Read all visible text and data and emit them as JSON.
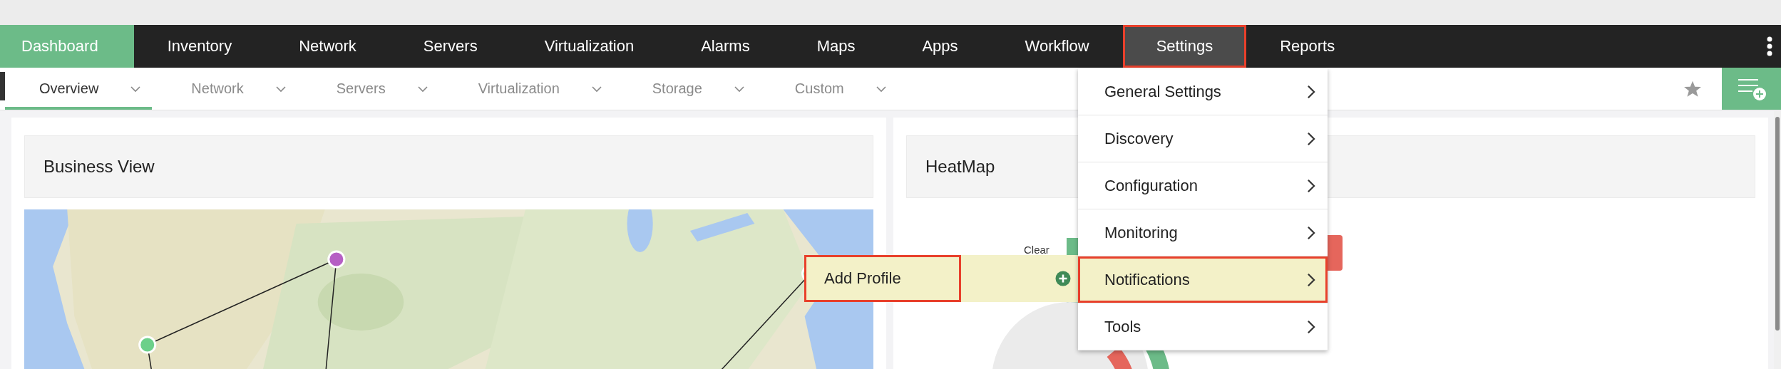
{
  "nav": {
    "items": [
      {
        "label": "Dashboard",
        "selected": true,
        "open": false,
        "highlighted": false
      },
      {
        "label": "Inventory",
        "selected": false,
        "open": false,
        "highlighted": false
      },
      {
        "label": "Network",
        "selected": false,
        "open": false,
        "highlighted": false
      },
      {
        "label": "Servers",
        "selected": false,
        "open": false,
        "highlighted": false
      },
      {
        "label": "Virtualization",
        "selected": false,
        "open": false,
        "highlighted": false
      },
      {
        "label": "Alarms",
        "selected": false,
        "open": false,
        "highlighted": false
      },
      {
        "label": "Maps",
        "selected": false,
        "open": false,
        "highlighted": false
      },
      {
        "label": "Apps",
        "selected": false,
        "open": false,
        "highlighted": false
      },
      {
        "label": "Workflow",
        "selected": false,
        "open": false,
        "highlighted": false
      },
      {
        "label": "Settings",
        "selected": false,
        "open": true,
        "highlighted": true
      },
      {
        "label": "Reports",
        "selected": false,
        "open": false,
        "highlighted": false
      }
    ]
  },
  "subnav": {
    "tabs": [
      {
        "label": "Overview",
        "selected": true
      },
      {
        "label": "Network",
        "selected": false
      },
      {
        "label": "Servers",
        "selected": false
      },
      {
        "label": "Virtualization",
        "selected": false
      },
      {
        "label": "Storage",
        "selected": false
      },
      {
        "label": "Custom",
        "selected": false
      }
    ]
  },
  "cards": [
    {
      "title": "Business View",
      "kind": "map"
    },
    {
      "title": "HeatMap",
      "kind": "heatmap",
      "legend_label": "Clear"
    }
  ],
  "settings_menu": {
    "items": [
      {
        "label": "General Settings",
        "active": false,
        "highlighted": false
      },
      {
        "label": "Discovery",
        "active": false,
        "highlighted": false
      },
      {
        "label": "Configuration",
        "active": false,
        "highlighted": false
      },
      {
        "label": "Monitoring",
        "active": false,
        "highlighted": false
      },
      {
        "label": "Notifications",
        "active": true,
        "highlighted": true
      },
      {
        "label": "Tools",
        "active": false,
        "highlighted": false
      }
    ]
  },
  "submenu": {
    "items": [
      {
        "label": "Add Profile",
        "highlighted": true
      }
    ]
  }
}
